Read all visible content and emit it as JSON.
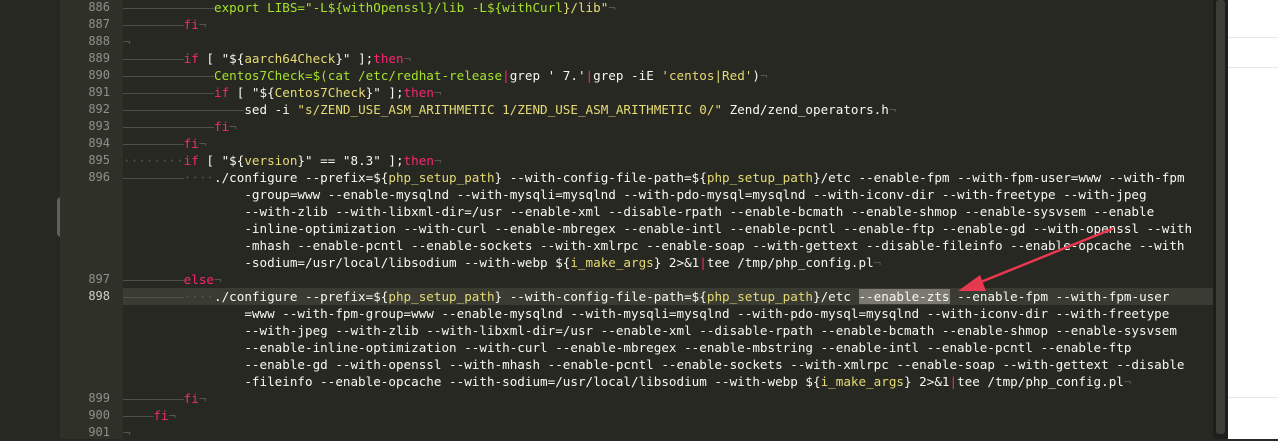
{
  "gutter": {
    "line_numbers": [
      "886",
      "887",
      "888",
      "889",
      "890",
      "891",
      "892",
      "893",
      "894",
      "895",
      "896",
      "897",
      "898",
      "899",
      "900",
      "901"
    ],
    "current_line": "898"
  },
  "code": {
    "l886": [
      "export LIBS=\"-L${",
      "withOpenssl",
      "}/lib -L${",
      "withCurl",
      "}/lib\""
    ],
    "l887": [
      "fi"
    ],
    "l889": [
      "if",
      " [ \"${",
      "aarch64Check",
      "}\" ];",
      "then"
    ],
    "l890": [
      "Centos7Check=$(cat /etc/redhat-release",
      "|",
      "grep ' 7.'",
      "|",
      "grep -iE ",
      "'centos|Red'",
      ")"
    ],
    "l891": [
      "if",
      " [ \"${",
      "Centos7Check",
      "}\" ];",
      "then"
    ],
    "l892": [
      "sed -i ",
      "\"s/ZEND_USE_ASM_ARITHMETIC 1/ZEND_USE_ASM_ARITHMETIC 0/\"",
      "",
      " Zend/zend_operators.h"
    ],
    "l893": [
      "fi"
    ],
    "l894": [
      "fi"
    ],
    "l895": [
      "if",
      " [ \"${",
      "version",
      "}\" == \"8.3\" ];",
      "then"
    ],
    "l896a": [
      "./configure --prefix=${",
      "php_setup_path",
      "} --with-config-file-path=${",
      "php_setup_path",
      "}/etc --enable-fpm --with-fpm-user=www --with-fpm"
    ],
    "l896b": "-group=www --enable-mysqlnd --with-mysqli=mysqlnd --with-pdo-mysql=mysqlnd --with-iconv-dir --with-freetype --with-jpeg",
    "l896c": "--with-zlib --with-libxml-dir=/usr --enable-xml --disable-rpath --enable-bcmath --enable-shmop --enable-sysvsem --enable",
    "l896d": "-inline-optimization --with-curl --enable-mbregex --enable-intl --enable-pcntl --enable-ftp --enable-gd --with-openssl --with",
    "l896e": "-mhash --enable-pcntl --enable-sockets --with-xmlrpc --enable-soap --with-gettext --disable-fileinfo --enable-opcache --with",
    "l896f": [
      "-sodium=/usr/local/libsodium --with-webp ${",
      "i_make_args",
      "} 2>&1",
      "|",
      "tee /tmp/php_config.pl"
    ],
    "l897": [
      "else"
    ],
    "l898a": [
      "./configure --prefix=${",
      "php_setup_path",
      "} --with-config-file-path=${",
      "php_setup_path",
      "}/etc ",
      "--enable-zts",
      " --enable-fpm --with-fpm-user"
    ],
    "l898b": "=www --with-fpm-group=www --enable-mysqlnd --with-mysqli=mysqlnd --with-pdo-mysql=mysqlnd --with-iconv-dir --with-freetype",
    "l898c": "--with-jpeg --with-zlib --with-libxml-dir=/usr --enable-xml --disable-rpath --enable-bcmath --enable-shmop --enable-sysvsem",
    "l898d": "--enable-inline-optimization --with-curl --enable-mbregex --enable-mbstring --enable-intl --enable-pcntl --enable-ftp",
    "l898e": "--enable-gd --with-openssl --with-mhash --enable-pcntl --enable-sockets --with-xmlrpc --enable-soap --with-gettext --disable",
    "l898f": [
      "-fileinfo --enable-opcache --with-sodium=/usr/local/libsodium --with-webp ${",
      "i_make_args",
      "} 2>&1",
      "|",
      "tee /tmp/php_config.pl"
    ],
    "l899": [
      "fi"
    ],
    "l900": [
      "fi"
    ]
  },
  "colors": {
    "keyword": "#f92672",
    "string": "#e6db74",
    "variable": "#a6e22e",
    "text": "#f8f8f2",
    "annotation_arrow": "#e8384f"
  }
}
